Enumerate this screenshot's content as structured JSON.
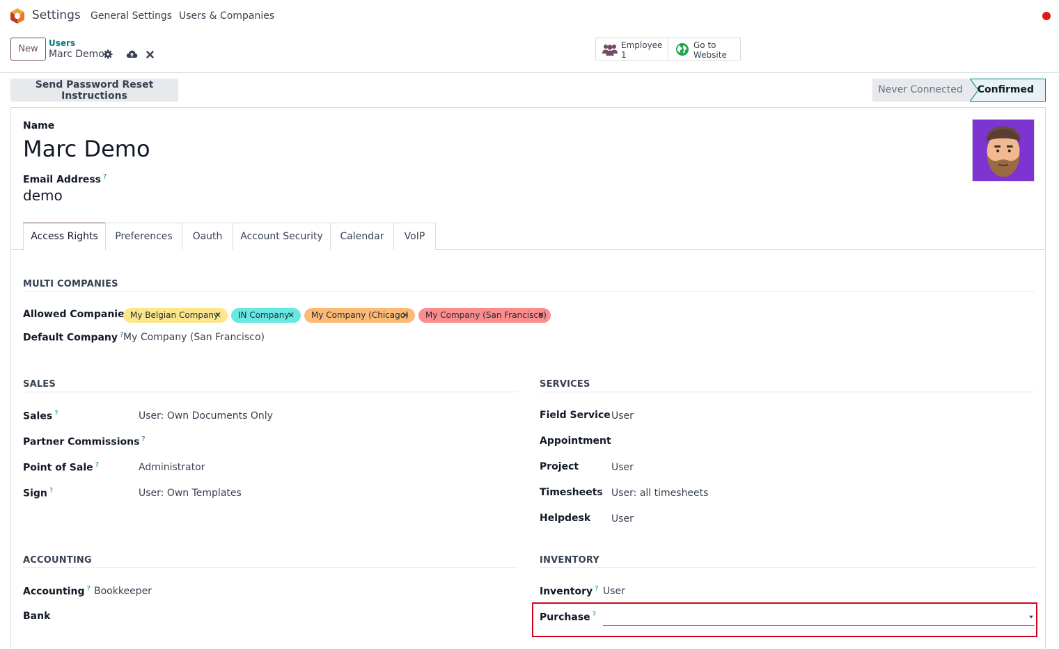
{
  "nav": {
    "app_name": "Settings",
    "items": [
      "General Settings",
      "Users & Companies"
    ]
  },
  "control": {
    "new_label": "New",
    "breadcrumb_parent": "Users",
    "breadcrumb_current": "Marc Demo",
    "smart_buttons": [
      {
        "line1": "Employee",
        "line2": "1"
      },
      {
        "line1": "Go to",
        "line2": "Website"
      }
    ]
  },
  "actions": {
    "reset_label": "Send Password Reset Instructions",
    "status_never": "Never Connected",
    "status_confirmed": "Confirmed"
  },
  "form": {
    "name_label": "Name",
    "name_value": "Marc Demo",
    "email_label": "Email Address",
    "email_value": "demo",
    "help_mark": "?"
  },
  "tabs": [
    "Access Rights",
    "Preferences",
    "Oauth",
    "Account Security",
    "Calendar",
    "VoIP"
  ],
  "multi_companies": {
    "title": "MULTI COMPANIES",
    "allowed_label": "Allowed Companies",
    "companies": [
      "My Belgian Company",
      "IN Company",
      "My Company (Chicago)",
      "My Company (San Francisco)"
    ],
    "default_label": "Default Company",
    "default_value": "My Company (San Francisco)"
  },
  "sales": {
    "title": "SALES",
    "rows": [
      {
        "label": "Sales",
        "value": "User: Own Documents Only"
      },
      {
        "label": "Partner Commissions",
        "value": ""
      },
      {
        "label": "Point of Sale",
        "value": "Administrator"
      },
      {
        "label": "Sign",
        "value": "User: Own Templates"
      }
    ]
  },
  "services": {
    "title": "SERVICES",
    "rows": [
      {
        "label": "Field Service",
        "value": "User"
      },
      {
        "label": "Appointment",
        "value": ""
      },
      {
        "label": "Project",
        "value": "User"
      },
      {
        "label": "Timesheets",
        "value": "User: all timesheets"
      },
      {
        "label": "Helpdesk",
        "value": "User"
      }
    ]
  },
  "accounting": {
    "title": "ACCOUNTING",
    "rows": [
      {
        "label": "Accounting",
        "value": "Bookkeeper"
      },
      {
        "label": "Bank",
        "value": ""
      }
    ]
  },
  "inventory": {
    "title": "INVENTORY",
    "rows": [
      {
        "label": "Inventory",
        "value": "User"
      },
      {
        "label": "Purchase",
        "value": ""
      }
    ]
  },
  "colors": {
    "brand": "#714b67",
    "accent": "#017e84",
    "tag_belgian": "#fde68a",
    "tag_in": "#67e8e1",
    "tag_chicago": "#fdba74",
    "tag_sf": "#fc8d8d",
    "status_dot": "#e41616"
  }
}
